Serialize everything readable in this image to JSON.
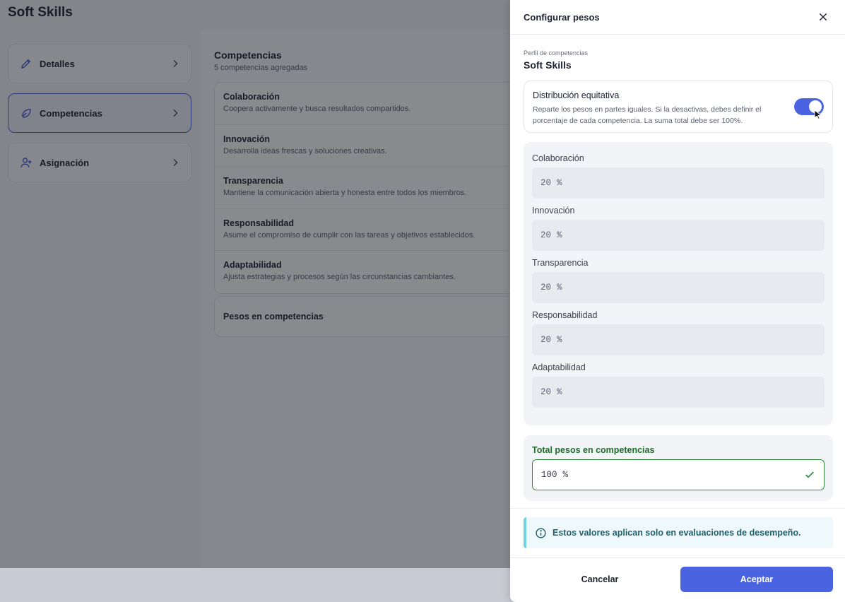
{
  "app": {
    "title": "Soft Skills",
    "nav": [
      {
        "label": "Detalles",
        "icon": "pencil-icon",
        "active": false
      },
      {
        "label": "Competencias",
        "icon": "leaf-icon",
        "active": true
      },
      {
        "label": "Asignación",
        "icon": "user-add-icon",
        "active": false
      }
    ],
    "section_title": "Competencias",
    "section_subtitle": "5 competencias agregadas",
    "competencies": [
      {
        "name": "Colaboración",
        "desc": "Coopera activamente y busca resultados compartidos."
      },
      {
        "name": "Innovación",
        "desc": "Desarrolla ideas frescas y soluciones creativas."
      },
      {
        "name": "Transparencia",
        "desc": "Mantiene la comunicación abierta y honesta entre todos los miembros."
      },
      {
        "name": "Responsabilidad",
        "desc": "Asume el compromiso de cumplir con las tareas y objetivos establecidos."
      },
      {
        "name": "Adaptabilidad",
        "desc": "Ajusta estrategias y procesos según las circunstancias cambiantes."
      }
    ],
    "weights_section": "Pesos en competencias"
  },
  "drawer": {
    "title": "Configurar pesos",
    "profile_label": "Perfil de competencias",
    "profile_name": "Soft Skills",
    "toggle_title": "Distribución equitativa",
    "toggle_desc": "Reparte los pesos en partes iguales. Si la desactivas, debes definir el porcentaje de cada competencia. La suma total debe ser 100%.",
    "toggle_on": true,
    "weights": [
      {
        "label": "Colaboración",
        "value": "20",
        "unit": "%"
      },
      {
        "label": "Innovación",
        "value": "20",
        "unit": "%"
      },
      {
        "label": "Transparencia",
        "value": "20",
        "unit": "%"
      },
      {
        "label": "Responsabilidad",
        "value": "20",
        "unit": "%"
      },
      {
        "label": "Adaptabilidad",
        "value": "20",
        "unit": "%"
      }
    ],
    "total_label": "Total pesos en competencias",
    "total_value": "100",
    "total_unit": "%",
    "info_text": "Estos valores aplican solo en evaluaciones de desempeño.",
    "cancel_label": "Cancelar",
    "accept_label": "Aceptar"
  },
  "colors": {
    "accent": "#4a63e0",
    "success": "#2e8b3a",
    "info": "#6fd3e0"
  }
}
